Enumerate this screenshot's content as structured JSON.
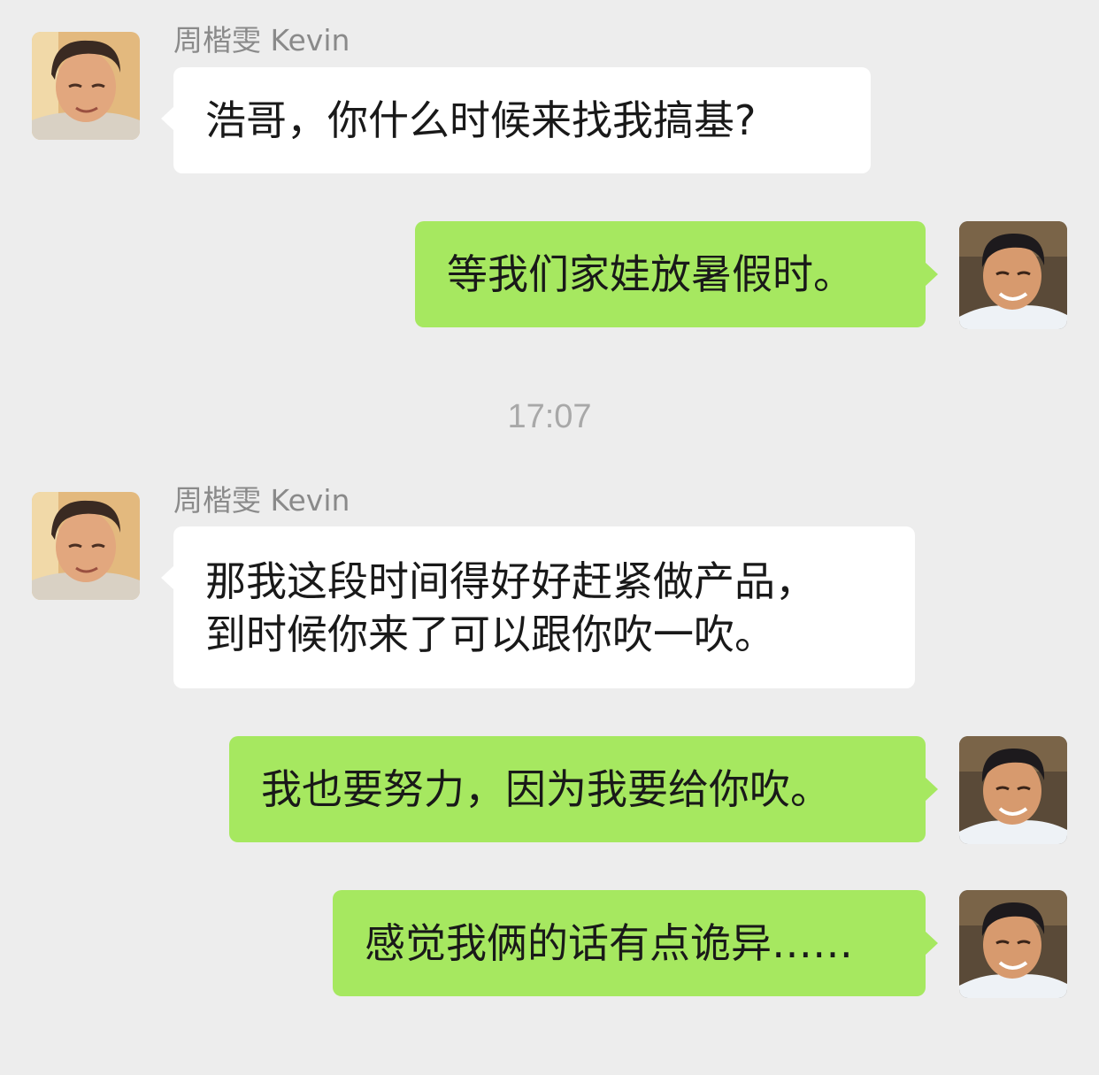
{
  "chat": {
    "contact_name": "周楷雯 Kevin",
    "timestamp": "17:07",
    "messages": [
      {
        "from": "contact",
        "text": "浩哥，你什么时候来找我搞基?"
      },
      {
        "from": "me",
        "text": "等我们家娃放暑假时。"
      },
      {
        "from": "contact",
        "text": "那我这段时间得好好赶紧做产品，\n到时候你来了可以跟你吹一吹。"
      },
      {
        "from": "me",
        "text": "我也要努力，因为我要给你吹。"
      },
      {
        "from": "me",
        "text": "感觉我俩的话有点诡异……"
      }
    ]
  },
  "colors": {
    "background": "#ededed",
    "incoming_bubble": "#ffffff",
    "outgoing_bubble": "#a6e860",
    "name_text": "#8a8a8a",
    "timestamp_text": "#a8a8a8"
  },
  "icons": {
    "contact_avatar": "contact-avatar-photo",
    "my_avatar": "my-avatar-photo"
  }
}
